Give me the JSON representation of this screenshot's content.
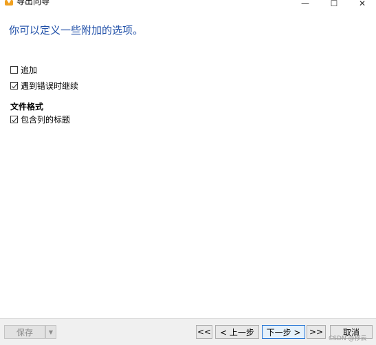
{
  "window": {
    "title": "导出向导",
    "minimize_glyph": "—",
    "maximize_glyph": "☐",
    "close_glyph": "✕"
  },
  "heading": "你可以定义一些附加的选项。",
  "options": {
    "append": {
      "label": "追加",
      "checked": false
    },
    "continue_on_error": {
      "label": "遇到错误时继续",
      "checked": true
    }
  },
  "file_format": {
    "title": "文件格式",
    "include_column_titles": {
      "label": "包含列的标题",
      "checked": true
    }
  },
  "footer": {
    "save_label": "保存",
    "save_dropdown_glyph": "▼",
    "first_label": "<<",
    "prev_label": "< 上一步",
    "next_label": "下一步 >",
    "last_label": ">>",
    "cancel_label": "取消"
  },
  "watermark": "CSDN @移云",
  "icons": {
    "app": "export-wizard-icon",
    "checkbox": "checkbox"
  },
  "colors": {
    "heading": "#1f4fa8",
    "default_button_border": "#2a78d4"
  }
}
